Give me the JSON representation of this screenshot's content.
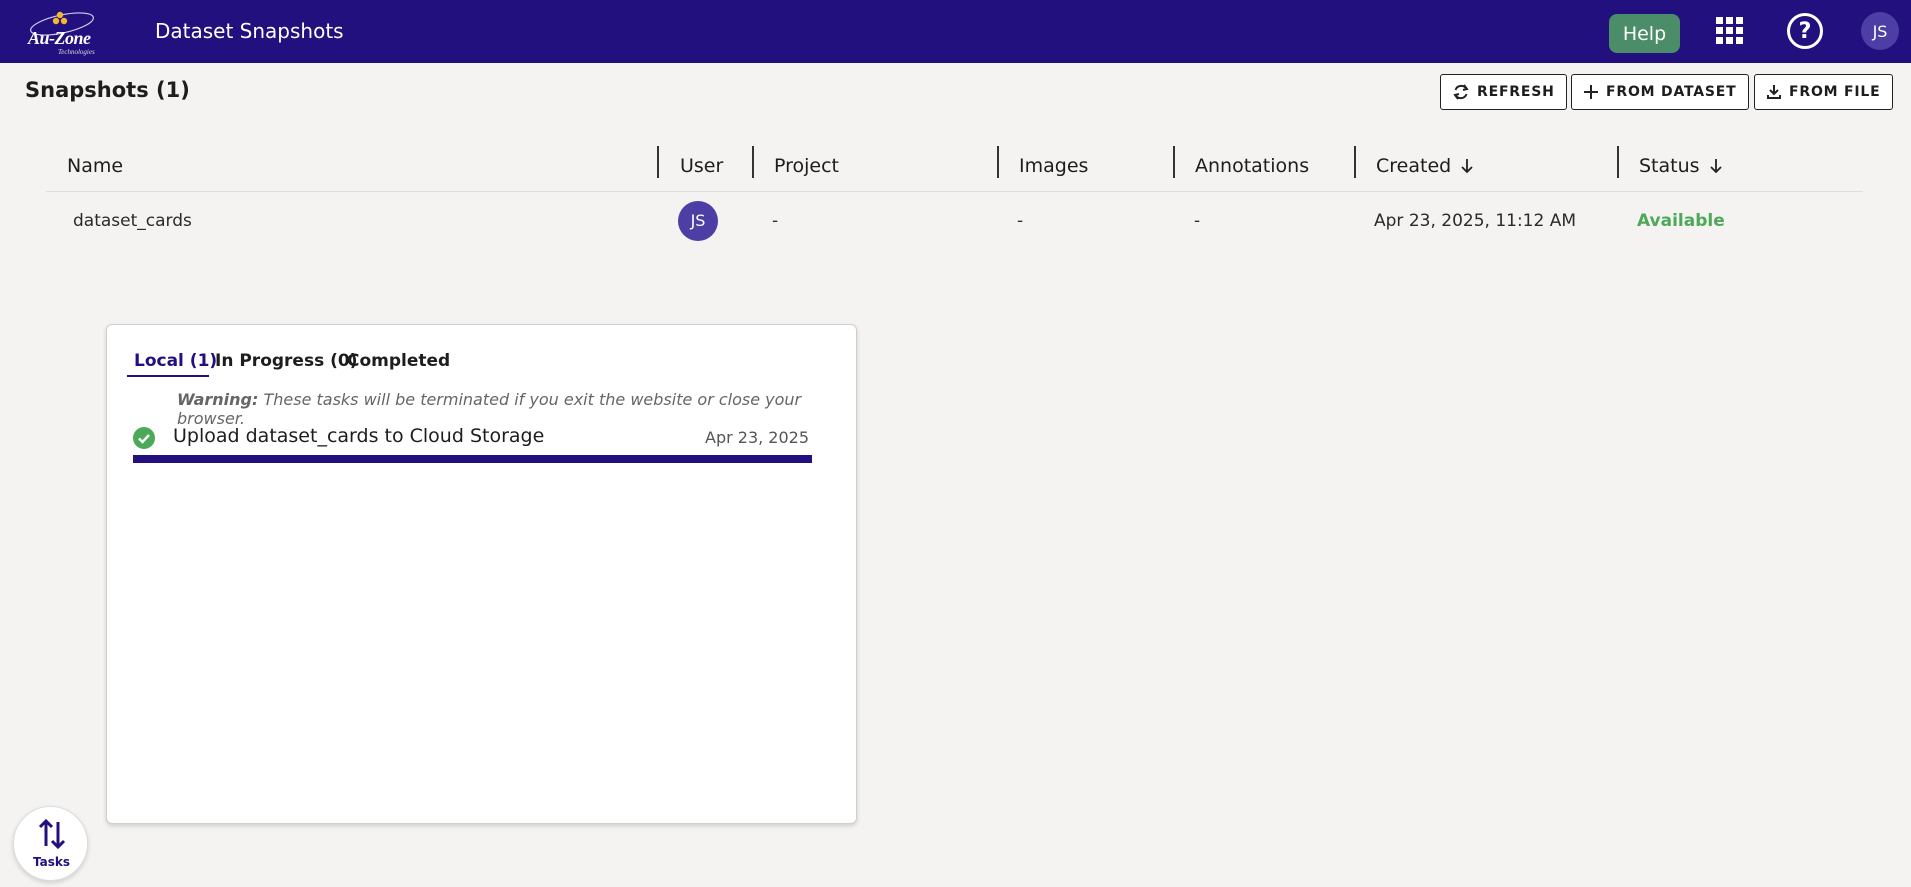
{
  "header": {
    "logo_text": "Au-Zone",
    "logo_subtext": "Technologies",
    "title": "Dataset Snapshots",
    "help_label": "Help",
    "user_initials": "JS",
    "apps_icon": "apps-grid-icon",
    "help_icon": "question-circle-icon"
  },
  "page": {
    "title": "Snapshots (1)"
  },
  "toolbar": {
    "refresh_label": "REFRESH",
    "from_dataset_label": "FROM DATASET",
    "from_file_label": "FROM FILE"
  },
  "table": {
    "columns": [
      "Name",
      "User",
      "Project",
      "Images",
      "Annotations",
      "Created",
      "Status"
    ],
    "sort_icon": "arrow-down-icon",
    "rows": [
      {
        "name": "dataset_cards",
        "user": "JS",
        "project": "-",
        "images": "-",
        "annotations": "-",
        "created": "Apr 23, 2025, 11:12 AM",
        "status": "Available",
        "status_color": "#4ea85a"
      }
    ]
  },
  "tasks_panel": {
    "tabs": [
      "Local (1)",
      "In Progress (0)",
      "Completed"
    ],
    "active_tab": "Local (1)",
    "warning_label": "Warning:",
    "warning_text": "These tasks will be terminated if you exit the website or close your browser.",
    "items": [
      {
        "title": "Upload dataset_cards to Cloud Storage",
        "date": "Apr 23, 2025",
        "status_icon": "check-circle-icon",
        "progress_fraction": 1.0
      }
    ]
  },
  "tasks_button": {
    "label": "Tasks",
    "icon": "up-down-arrows-icon"
  },
  "colors": {
    "brand": "#22107f",
    "help_button": "#4b8d68",
    "success": "#4ea85a",
    "avatar": "#4d3ea6"
  }
}
